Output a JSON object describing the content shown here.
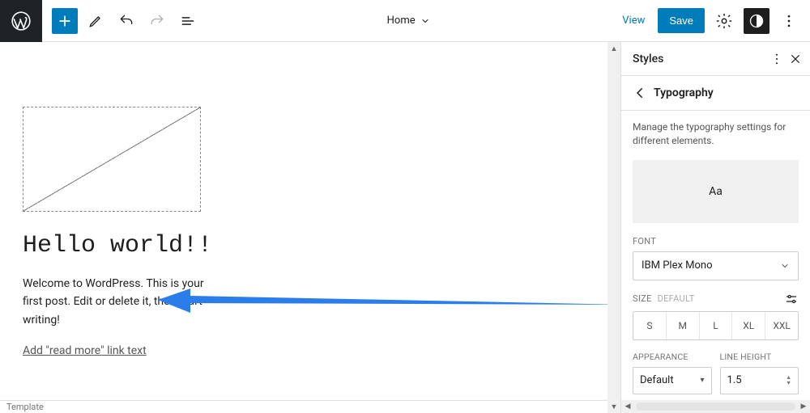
{
  "topbar": {
    "page_title": "Home",
    "view_label": "View",
    "save_label": "Save"
  },
  "canvas": {
    "post_title": "Hello world!!",
    "post_excerpt": "Welcome to WordPress. This is your first post. Edit or delete it, then start writing!",
    "read_more_placeholder": "Add \"read more\" link text",
    "footer": "Template"
  },
  "panel": {
    "title": "Styles",
    "section": "Typography",
    "description": "Manage the typography settings for different elements.",
    "preview_sample": "Aa",
    "font_label": "FONT",
    "font_value": "IBM Plex Mono",
    "size_label": "SIZE",
    "size_suffix": "DEFAULT",
    "sizes": [
      "S",
      "M",
      "L",
      "XL",
      "XXL"
    ],
    "appearance_label": "APPEARANCE",
    "appearance_value": "Default",
    "lineheight_label": "LINE HEIGHT",
    "lineheight_value": "1.5"
  }
}
